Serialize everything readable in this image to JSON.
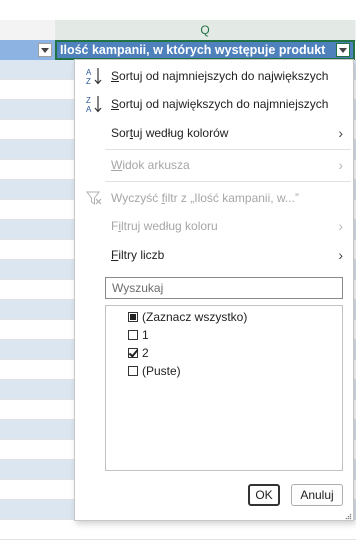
{
  "sheet": {
    "column_letter": "Q",
    "header_text": "Ilość kampanii, w których występuje produkt",
    "accent": "#217346",
    "header_fill": "#4f81bd",
    "band_fill": "#dce6f1"
  },
  "menu": {
    "sort_asc": {
      "pre": "",
      "u": "S",
      "post": "ortuj od najmniejszych do największych"
    },
    "sort_desc": {
      "pre": "",
      "u": "S",
      "post": "ortuj od największych do najmniejszych"
    },
    "sort_color": {
      "pre": "Sor",
      "u": "t",
      "post": "uj według kolorów"
    },
    "sheet_view": {
      "pre": "",
      "u": "W",
      "post": "idok arkusza"
    },
    "clear_filter": {
      "pre": "Wyczyść ",
      "u": "f",
      "post": "iltr z „Ilość kampanii, w...”"
    },
    "filter_color": {
      "pre": "F",
      "u": "i",
      "post": "ltruj według koloru"
    },
    "number_filters": {
      "pre": "",
      "u": "F",
      "post": "iltry liczb"
    }
  },
  "search": {
    "placeholder": "Wyszukaj"
  },
  "list": [
    {
      "label": "(Zaznacz wszystko)",
      "state": "partial"
    },
    {
      "label": "1",
      "state": "unchecked"
    },
    {
      "label": "2",
      "state": "checked"
    },
    {
      "label": "(Puste)",
      "state": "unchecked"
    }
  ],
  "buttons": {
    "ok": "OK",
    "cancel": "Anuluj"
  }
}
